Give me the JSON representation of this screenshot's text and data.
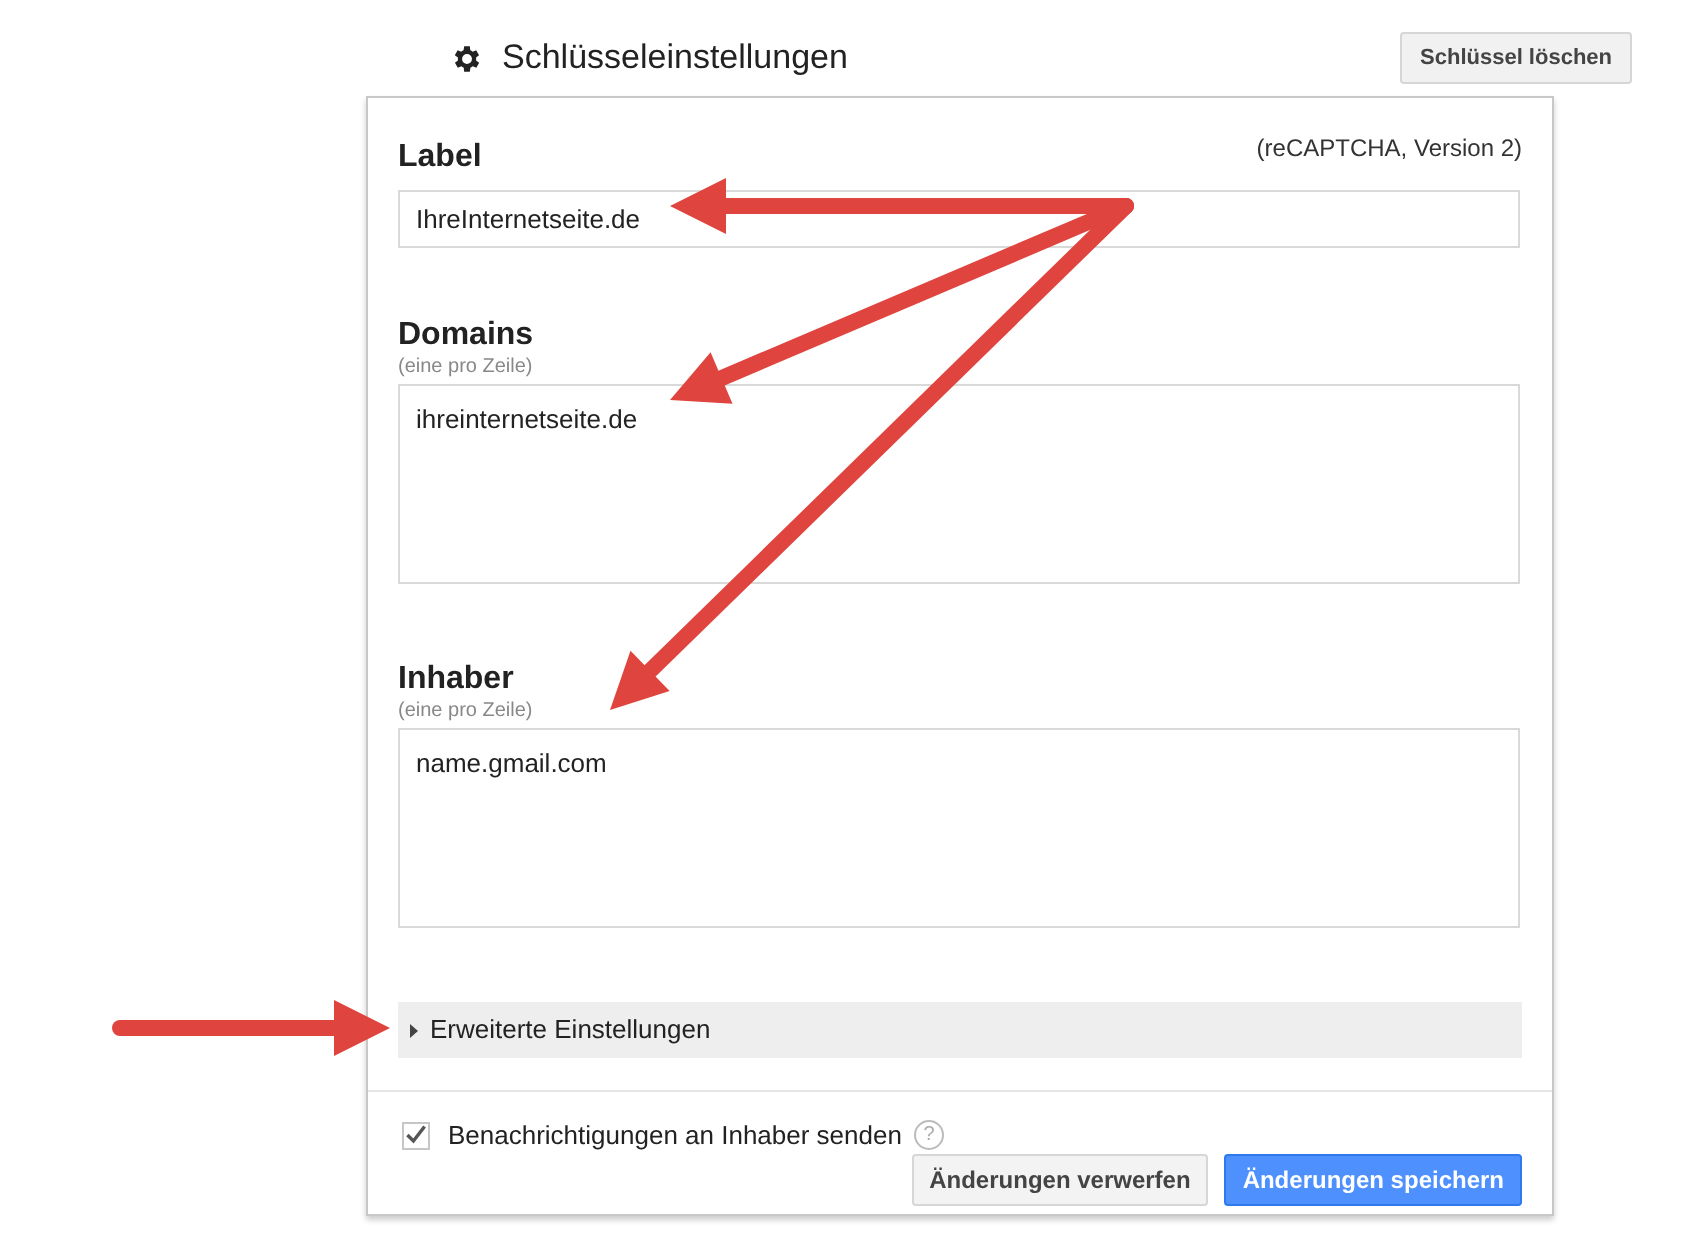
{
  "header": {
    "title": "Schlüsseleinstellungen",
    "delete_button": "Schlüssel löschen"
  },
  "card": {
    "version_note": "(reCAPTCHA, Version 2)",
    "fields": [
      {
        "kind": "input",
        "label": "Label",
        "value": "IhreInternetseite.de"
      },
      {
        "kind": "textarea",
        "label": "Domains",
        "hint": "(eine pro Zeile)",
        "value": "ihreinternetseite.de"
      },
      {
        "kind": "textarea",
        "label": "Inhaber",
        "hint": "(eine pro Zeile)",
        "value": "name.gmail.com"
      }
    ],
    "advanced": {
      "label": "Erweiterte Einstellungen",
      "expanded": false
    },
    "notify": {
      "label": "Benachrichtigungen an Inhaber senden",
      "checked": true,
      "help": "?"
    },
    "buttons": [
      {
        "kind": "secondary",
        "label": "Änderungen verwerfen"
      },
      {
        "kind": "primary",
        "label": "Änderungen speichern"
      }
    ]
  }
}
